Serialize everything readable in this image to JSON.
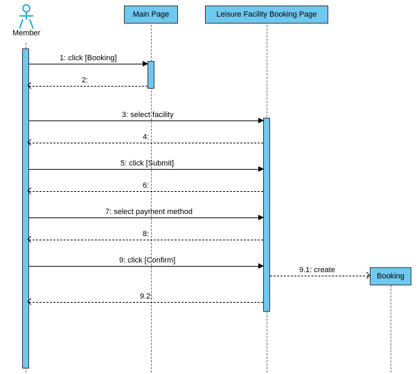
{
  "actor": {
    "label": "Member"
  },
  "lifelines": {
    "main_page": {
      "label": "Main Page"
    },
    "booking_page": {
      "label": "Leisure Facility Booking Page"
    },
    "booking": {
      "label": "Booking"
    }
  },
  "messages": {
    "m1": {
      "label": "1: click [Booking]"
    },
    "m2": {
      "label": "2:"
    },
    "m3": {
      "label": "3: select facility"
    },
    "m4": {
      "label": "4:"
    },
    "m5": {
      "label": "5: click [Submit]"
    },
    "m6": {
      "label": "6:"
    },
    "m7": {
      "label": "7: select payment method"
    },
    "m8": {
      "label": "8:"
    },
    "m9": {
      "label": "9: click [Confirm]"
    },
    "m91": {
      "label": "9.1: create"
    },
    "m92": {
      "label": "9.2:"
    }
  },
  "chart_data": {
    "type": "sequence-diagram",
    "participants": [
      {
        "id": "member",
        "kind": "actor",
        "name": "Member"
      },
      {
        "id": "main_page",
        "kind": "object",
        "name": "Main Page"
      },
      {
        "id": "booking_page",
        "kind": "object",
        "name": "Leisure Facility Booking Page"
      },
      {
        "id": "booking",
        "kind": "object",
        "name": "Booking"
      }
    ],
    "messages": [
      {
        "seq": "1",
        "from": "member",
        "to": "main_page",
        "label": "click [Booking]",
        "type": "sync"
      },
      {
        "seq": "2",
        "from": "main_page",
        "to": "member",
        "label": "",
        "type": "return"
      },
      {
        "seq": "3",
        "from": "member",
        "to": "booking_page",
        "label": "select facility",
        "type": "sync"
      },
      {
        "seq": "4",
        "from": "booking_page",
        "to": "member",
        "label": "",
        "type": "return"
      },
      {
        "seq": "5",
        "from": "member",
        "to": "booking_page",
        "label": "click [Submit]",
        "type": "sync"
      },
      {
        "seq": "6",
        "from": "booking_page",
        "to": "member",
        "label": "",
        "type": "return"
      },
      {
        "seq": "7",
        "from": "member",
        "to": "booking_page",
        "label": "select payment method",
        "type": "sync"
      },
      {
        "seq": "8",
        "from": "booking_page",
        "to": "member",
        "label": "",
        "type": "return"
      },
      {
        "seq": "9",
        "from": "member",
        "to": "booking_page",
        "label": "click [Confirm]",
        "type": "sync"
      },
      {
        "seq": "9.1",
        "from": "booking_page",
        "to": "booking",
        "label": "create",
        "type": "create"
      },
      {
        "seq": "9.2",
        "from": "booking_page",
        "to": "member",
        "label": "",
        "type": "return"
      }
    ]
  }
}
